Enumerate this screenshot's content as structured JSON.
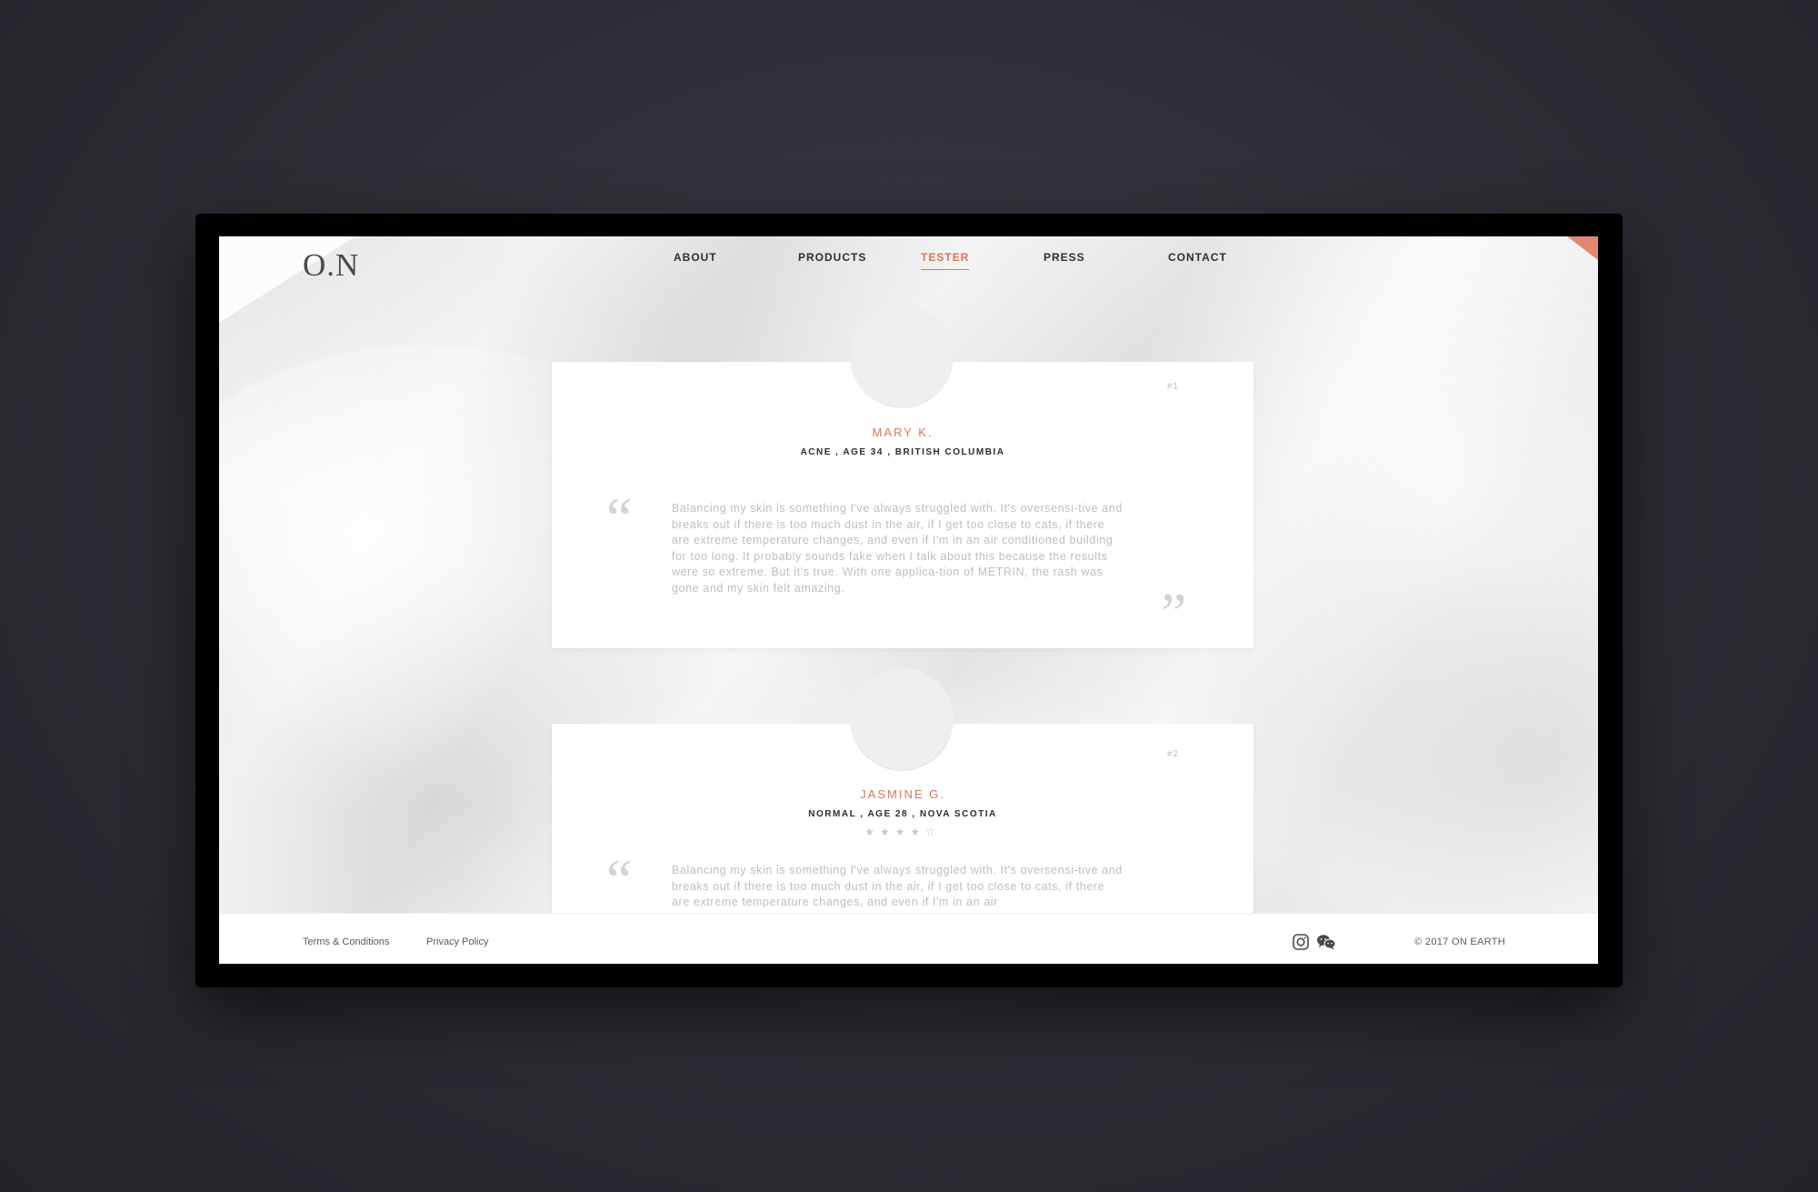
{
  "brand": {
    "logo": "O.N"
  },
  "nav": {
    "items": [
      {
        "label": "ABOUT"
      },
      {
        "label": "PRODUCTS"
      },
      {
        "label": "TESTER",
        "active": true
      },
      {
        "label": "PRESS"
      },
      {
        "label": "CONTACT"
      }
    ]
  },
  "testimonials": [
    {
      "number": "#1",
      "name": "MARY K.",
      "meta": "ACNE , AGE 34 , BRITISH COLUMBIA",
      "quote": "Balancing my skin is something I've always struggled with. It's oversensi-tive and breaks out if there is too much dust in the air, if I get too close to cats, if there are extreme temperature changes, and even if I'm in an air conditioned building for too long. It probably sounds fake when I talk about this because the results were so extreme. But it's true. With one applica-tion of METRIN, the rash was gone and my skin felt amazing."
    },
    {
      "number": "#2",
      "name": "JASMINE G.",
      "meta": "NORMAL , AGE 28 , NOVA SCOTIA",
      "rating": 4,
      "stars": "★★★★☆",
      "quote": "Balancing my skin is something I've always struggled with. It's oversensi-tive and breaks out if there is too much dust in the air, if I get too close to cats, if there are extreme temperature changes, and even if I'm in an air"
    }
  ],
  "quote_marks": {
    "open": "“",
    "close": "”"
  },
  "footer": {
    "terms": "Terms & Conditions",
    "privacy": "Privacy Policy",
    "copyright": "© 2017 ON EARTH",
    "social": [
      "instagram-icon",
      "wechat-icon"
    ]
  },
  "colors": {
    "accent": "#d9755c",
    "corner_accent": "#e2876f",
    "text_dark": "#2f2f2f"
  }
}
